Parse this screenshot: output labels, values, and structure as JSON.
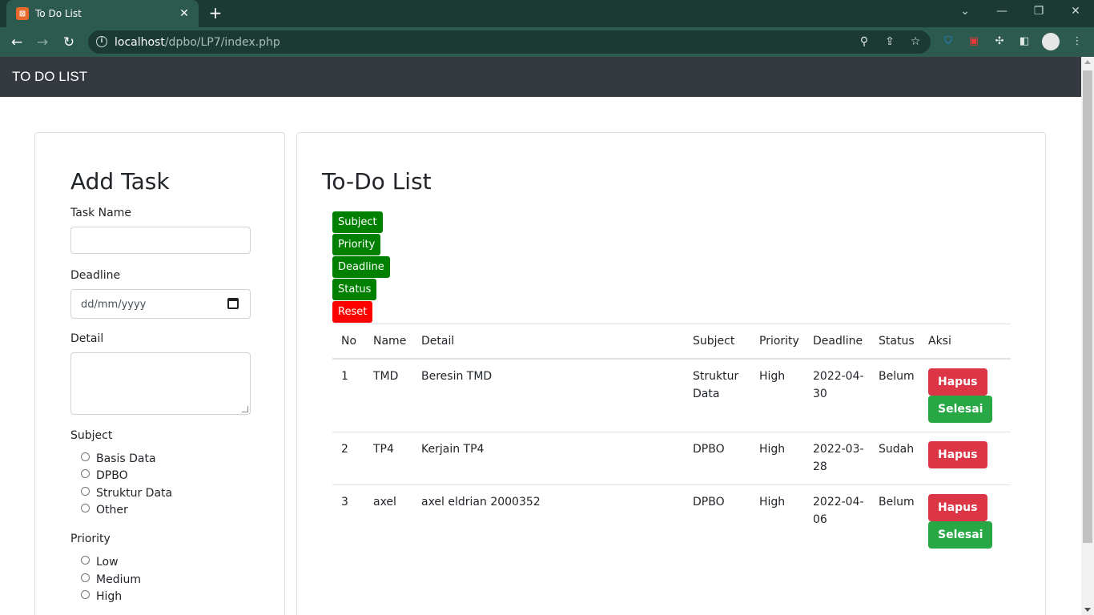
{
  "browser": {
    "tab_title": "To Do List",
    "tab_close": "✕",
    "new_tab": "+",
    "url_host": "localhost",
    "url_path": "/dpbo/LP7/index.php",
    "win_minimize": "—",
    "win_restore": "❐",
    "win_close": "✕",
    "tab_dropdown": "⌄"
  },
  "navbar": {
    "brand": "TO DO LIST"
  },
  "add_task": {
    "title": "Add Task",
    "task_name_label": "Task Name",
    "deadline_label": "Deadline",
    "deadline_placeholder": "dd/mm/yyyy",
    "detail_label": "Detail",
    "subject_label": "Subject",
    "subjects": [
      "Basis Data",
      "DPBO",
      "Struktur Data",
      "Other"
    ],
    "priority_label": "Priority",
    "priorities": [
      "Low",
      "Medium",
      "High"
    ]
  },
  "todo": {
    "title": "To-Do List",
    "sort_buttons": [
      "Subject",
      "Priority",
      "Deadline",
      "Status"
    ],
    "reset_label": "Reset",
    "headers": [
      "No",
      "Name",
      "Detail",
      "Subject",
      "Priority",
      "Deadline",
      "Status",
      "Aksi"
    ],
    "rows": [
      {
        "no": "1",
        "name": "TMD",
        "detail": "Beresin TMD",
        "subject_1": "Struktur",
        "subject_2": "Data",
        "priority": "High",
        "deadline_1": "2022-04-",
        "deadline_2": "30",
        "status": "Belum"
      },
      {
        "no": "2",
        "name": "TP4",
        "detail": "Kerjain TP4",
        "subject_1": "DPBO",
        "subject_2": "",
        "priority": "High",
        "deadline_1": "2022-03-",
        "deadline_2": "28",
        "status": "Sudah"
      },
      {
        "no": "3",
        "name": "axel",
        "detail": "axel eldrian 2000352",
        "subject_1": "DPBO",
        "subject_2": "",
        "priority": "High",
        "deadline_1": "2022-04-",
        "deadline_2": "06",
        "status": "Belum"
      }
    ],
    "hapus_label": "Hapus",
    "selesai_label": "Selesai"
  },
  "colors": {
    "navbar": "#343a40",
    "sort_green": "#008000",
    "reset_red": "#ff0000",
    "hapus": "#dc3545",
    "selesai": "#28a745"
  }
}
